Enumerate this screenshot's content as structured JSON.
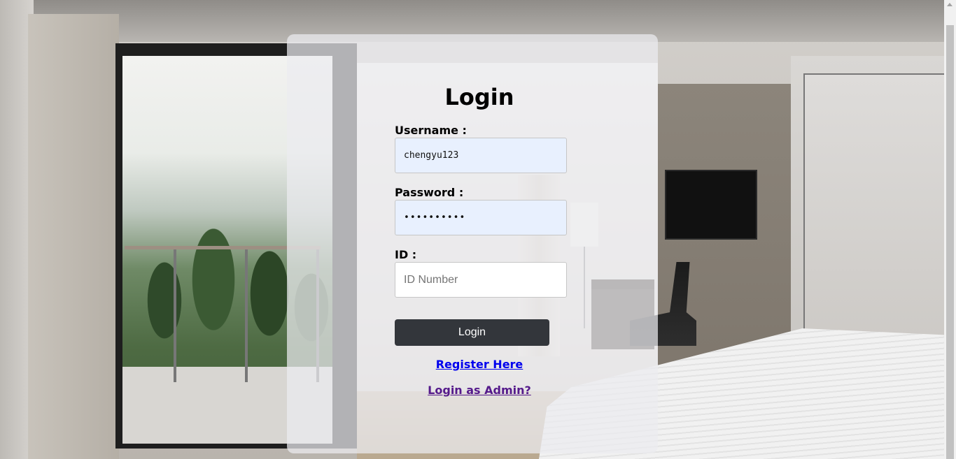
{
  "login_form": {
    "title": "Login",
    "username": {
      "label": "Username :",
      "value": "chengyu123"
    },
    "password": {
      "label": "Password :",
      "masked_value": "••••••••••"
    },
    "id": {
      "label": "ID :",
      "value": "",
      "placeholder": "ID Number"
    },
    "submit_label": "Login",
    "register_link": "Register Here",
    "admin_link": "Login as Admin?"
  },
  "colors": {
    "button_bg": "#33363b",
    "autofill_bg": "#e8f0fe",
    "link_unvisited": "#0000ee",
    "link_visited": "#551a8b"
  },
  "icons": {
    "scroll_up": "chevron-up-icon"
  }
}
